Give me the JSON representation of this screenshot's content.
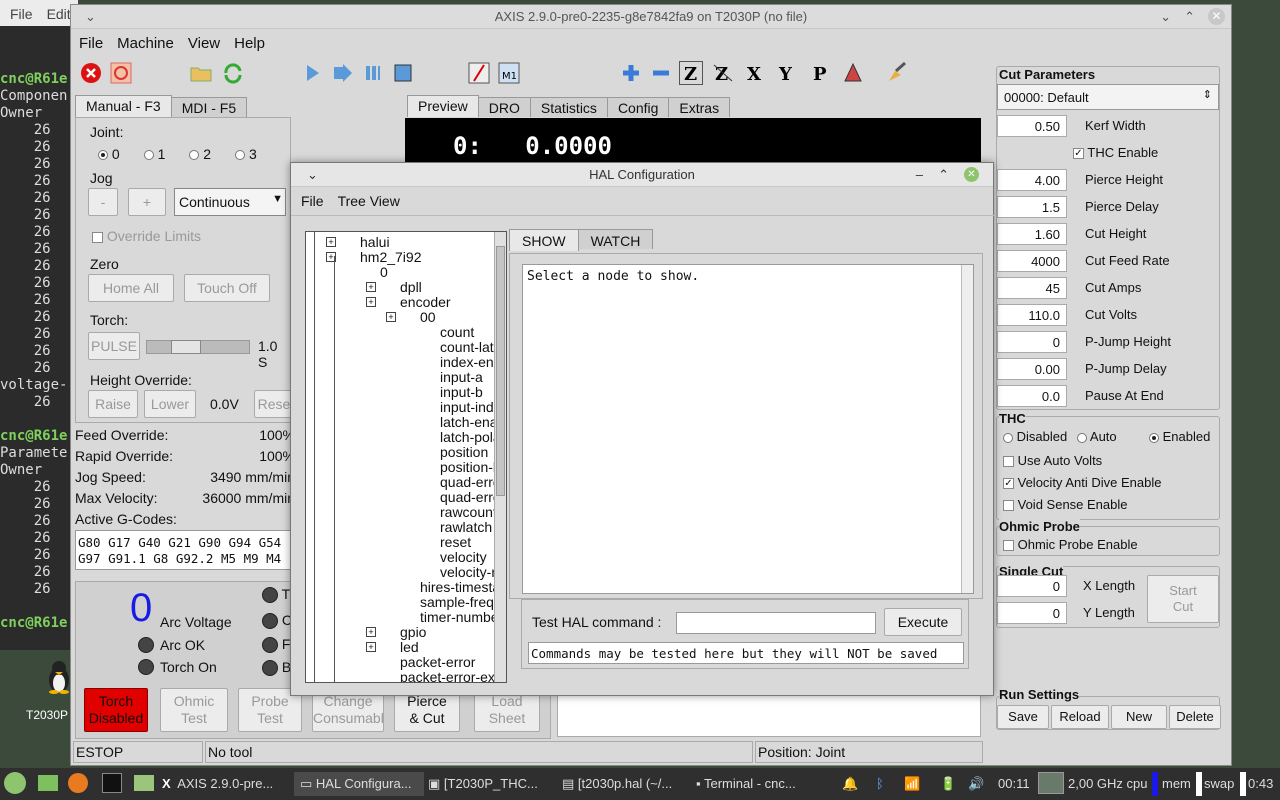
{
  "terminal": {
    "menu": [
      "File",
      "Edit"
    ],
    "lines": [
      {
        "text": "cnc@R61e",
        "prompt": true
      },
      {
        "text": "Componen"
      },
      {
        "text": "Owner"
      },
      {
        "text": "    26"
      },
      {
        "text": "    26"
      },
      {
        "text": "    26"
      },
      {
        "text": "    26"
      },
      {
        "text": "    26"
      },
      {
        "text": "    26"
      },
      {
        "text": "    26"
      },
      {
        "text": "    26"
      },
      {
        "text": "    26"
      },
      {
        "text": "    26"
      },
      {
        "text": "    26"
      },
      {
        "text": "    26"
      },
      {
        "text": "    26"
      },
      {
        "text": "    26"
      },
      {
        "text": "    26"
      },
      {
        "text": "voltage-"
      },
      {
        "text": "    26"
      },
      {
        "text": ""
      },
      {
        "text": "cnc@R61e",
        "prompt": true
      },
      {
        "text": "Paramete"
      },
      {
        "text": "Owner"
      },
      {
        "text": "    26"
      },
      {
        "text": "    26"
      },
      {
        "text": "    26"
      },
      {
        "text": "    26"
      },
      {
        "text": "    26"
      },
      {
        "text": "    26"
      },
      {
        "text": "    26"
      },
      {
        "text": ""
      },
      {
        "text": "cnc@R61e",
        "prompt": true
      }
    ],
    "desktop_icon_label": "T2030P"
  },
  "axis": {
    "title": "AXIS 2.9.0-pre0-2235-g8e7842fa9 on T2030P (no file)",
    "menu": [
      "File",
      "Machine",
      "View",
      "Help"
    ],
    "left_tabs": [
      "Manual - F3",
      "MDI - F5"
    ],
    "right_tabs": [
      "Preview",
      "DRO",
      "Statistics",
      "Config",
      "Extras"
    ],
    "joint_label": "Joint:",
    "joints": [
      "0",
      "1",
      "2",
      "3"
    ],
    "jog_label": "Jog",
    "jog_minus": "-",
    "jog_plus": "+",
    "jog_mode": "Continuous",
    "override_limits": "Override Limits",
    "zero_label": "Zero",
    "home_all": "Home All",
    "touch_off": "Touch Off",
    "torch_label": "Torch:",
    "pulse": "PULSE",
    "torch_time": "1.0 S",
    "height_override_label": "Height Override:",
    "raise": "Raise",
    "lower": "Lower",
    "height_value": "0.0V",
    "reset": "Rese",
    "stats": [
      {
        "label": "Feed Override:",
        "value": "100%"
      },
      {
        "label": "Rapid Override:",
        "value": "100%"
      },
      {
        "label": "Jog Speed:",
        "value": "3490 mm/min"
      },
      {
        "label": "Max Velocity:",
        "value": "36000 mm/min"
      }
    ],
    "active_gcodes_label": "Active G-Codes:",
    "gcodes_line1": "G80 G17 G40 G21 G90 G94 G54",
    "gcodes_line2": "G97 G91.1 G8 G92.2 M5 M9 M4",
    "dro_text": "0:   0.0000",
    "arc_voltage_value": "0",
    "arc_voltage_label": "Arc Voltage",
    "arc_ok_label": "Arc OK",
    "torch_on_label": "Torch On",
    "right_leds": [
      "T",
      "C",
      "F",
      "B"
    ],
    "buttons": [
      {
        "label": "Torch\nDisabled"
      },
      {
        "label": "Ohmic\nTest"
      },
      {
        "label": "Probe\nTest"
      },
      {
        "label": "Change\nConsumable"
      },
      {
        "label": "Pierce\n& Cut"
      },
      {
        "label": "Load\nSheet"
      }
    ],
    "status": {
      "estop": "ESTOP",
      "tool": "No tool",
      "position": "Position: Joint"
    }
  },
  "cut_parameters": {
    "title": "Cut Parameters",
    "material": "00000: Default",
    "fields": [
      {
        "value": "0.50",
        "label": "Kerf Width"
      },
      {
        "value": "",
        "label": "THC Enable",
        "checkbox": true,
        "checked": true
      },
      {
        "value": "4.00",
        "label": "Pierce Height"
      },
      {
        "value": "1.5",
        "label": "Pierce Delay"
      },
      {
        "value": "1.60",
        "label": "Cut Height"
      },
      {
        "value": "4000",
        "label": "Cut Feed Rate"
      },
      {
        "value": "45",
        "label": "Cut Amps"
      },
      {
        "value": "110.0",
        "label": "Cut Volts"
      },
      {
        "value": "0",
        "label": "P-Jump Height"
      },
      {
        "value": "0.00",
        "label": "P-Jump Delay"
      },
      {
        "value": "0.0",
        "label": "Pause At End"
      }
    ],
    "thc_title": "THC",
    "thc_modes": [
      "Disabled",
      "Auto",
      "Enabled"
    ],
    "thc_selected": "Enabled",
    "thc_options": [
      {
        "label": "Use Auto Volts",
        "checked": false
      },
      {
        "label": "Velocity Anti Dive Enable",
        "checked": true
      },
      {
        "label": "Void Sense Enable",
        "checked": false
      }
    ],
    "ohmic_title": "Ohmic Probe",
    "ohmic_enable": "Ohmic Probe Enable",
    "single_cut_title": "Single Cut",
    "x_length_value": "0",
    "x_length_label": "X Length",
    "y_length_value": "0",
    "y_length_label": "Y Length",
    "start_cut": "Start\nCut",
    "run_settings_title": "Run Settings",
    "run_buttons": [
      "Save",
      "Reload",
      "New",
      "Delete"
    ]
  },
  "hal": {
    "title": "HAL Configuration",
    "menu": [
      "File",
      "Tree View"
    ],
    "tree": [
      {
        "text": "halui",
        "level": 0,
        "expander": true
      },
      {
        "text": "hm2_7i92",
        "level": 0,
        "expander": true
      },
      {
        "text": "0",
        "level": 1,
        "expander": false
      },
      {
        "text": "dpll",
        "level": 2,
        "expander": true
      },
      {
        "text": "encoder",
        "level": 2,
        "expander": true
      },
      {
        "text": "00",
        "level": 3,
        "expander": true
      },
      {
        "text": "count",
        "level": 4
      },
      {
        "text": "count-latched",
        "level": 4
      },
      {
        "text": "index-enable",
        "level": 4
      },
      {
        "text": "input-a",
        "level": 4
      },
      {
        "text": "input-b",
        "level": 4
      },
      {
        "text": "input-index",
        "level": 4
      },
      {
        "text": "latch-enable",
        "level": 4
      },
      {
        "text": "latch-polarity",
        "level": 4
      },
      {
        "text": "position",
        "level": 4
      },
      {
        "text": "position-latche",
        "level": 4
      },
      {
        "text": "quad-error",
        "level": 4
      },
      {
        "text": "quad-error-en",
        "level": 4
      },
      {
        "text": "rawcounts",
        "level": 4
      },
      {
        "text": "rawlatch",
        "level": 4
      },
      {
        "text": "reset",
        "level": 4
      },
      {
        "text": "velocity",
        "level": 4
      },
      {
        "text": "velocity-rpm",
        "level": 4
      },
      {
        "text": "hires-timestam",
        "level": 3
      },
      {
        "text": "sample-frequer",
        "level": 3
      },
      {
        "text": "timer-number",
        "level": 3
      },
      {
        "text": "gpio",
        "level": 2,
        "expander": true
      },
      {
        "text": "led",
        "level": 2,
        "expander": true
      },
      {
        "text": "packet-error",
        "level": 2
      },
      {
        "text": "packet-error-exc",
        "level": 2
      }
    ],
    "tabs": [
      "SHOW",
      "WATCH"
    ],
    "show_text": "Select a node to show.",
    "cmd_label": "Test HAL command :",
    "cmd_value": "",
    "execute": "Execute",
    "note": "Commands may be tested here but they will NOT be saved"
  },
  "taskbar": {
    "tasks": [
      {
        "label": "AXIS 2.9.0-pre..."
      },
      {
        "label": "HAL Configura..."
      },
      {
        "label": "[T2030P_THC..."
      },
      {
        "label": "[t2030p.hal (~/..."
      },
      {
        "label": "Terminal - cnc..."
      }
    ],
    "time": "00:11",
    "cpu": "2,00 GHz cpu",
    "mem": "mem",
    "swap": "swap",
    "clock": "0:43"
  },
  "colors": {
    "torch_disabled": "#e00000",
    "arc_voltage": "#1a1ae6",
    "prompt": "#7fd15d",
    "taskbar": "#2f2f2f"
  }
}
